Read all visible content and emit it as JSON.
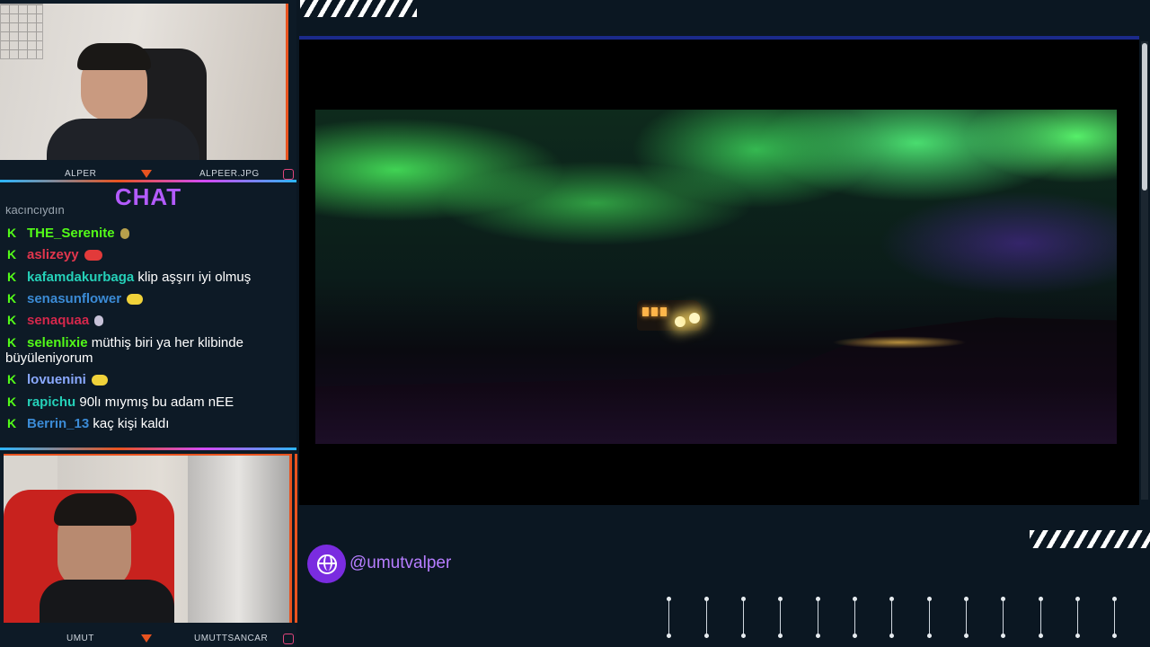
{
  "cams": {
    "top": {
      "left_label": "ALPER",
      "right_label": "ALPEER.JPG"
    },
    "bottom": {
      "left_label": "UMUT",
      "right_label": "UMUTTSANCAR"
    }
  },
  "chat": {
    "title": "CHAT",
    "cut_text": "kacıncıydın",
    "messages": [
      {
        "user": "THE_Serenite",
        "color": "#53fc18",
        "text": "",
        "emote": "#b7a04c"
      },
      {
        "user": "aslizeyy",
        "color": "#e2364d",
        "text": "",
        "emote": "#e23a3a"
      },
      {
        "user": "kafamdakurbaga",
        "color": "#25d0b8",
        "text": "klip aşşırı iyi olmuş",
        "emote": ""
      },
      {
        "user": "senasunflower",
        "color": "#3b8bd6",
        "text": "",
        "emote": "#f0d23a"
      },
      {
        "user": "senaquaa",
        "color": "#d4274b",
        "text": "",
        "emote": "#c7c2d8"
      },
      {
        "user": "selenlixie",
        "color": "#53fc18",
        "text": "müthiş biri ya her klibinde büyüleniyorum",
        "emote": ""
      },
      {
        "user": "lovuenini",
        "color": "#8aa9ff",
        "text": "",
        "emote": "#f0d23a"
      },
      {
        "user": "rapichu",
        "color": "#25d0b8",
        "text": "90lı mıymış bu adam nEE",
        "emote": ""
      },
      {
        "user": "Berrin_13",
        "color": "#3b8bd6",
        "text": "kaç kişi kaldı",
        "emote": ""
      }
    ]
  },
  "social": {
    "handle": "@umutvalper"
  },
  "colors": {
    "accent": "#e8531f",
    "kick_green": "#53fc18",
    "purple": "#b35bff"
  }
}
